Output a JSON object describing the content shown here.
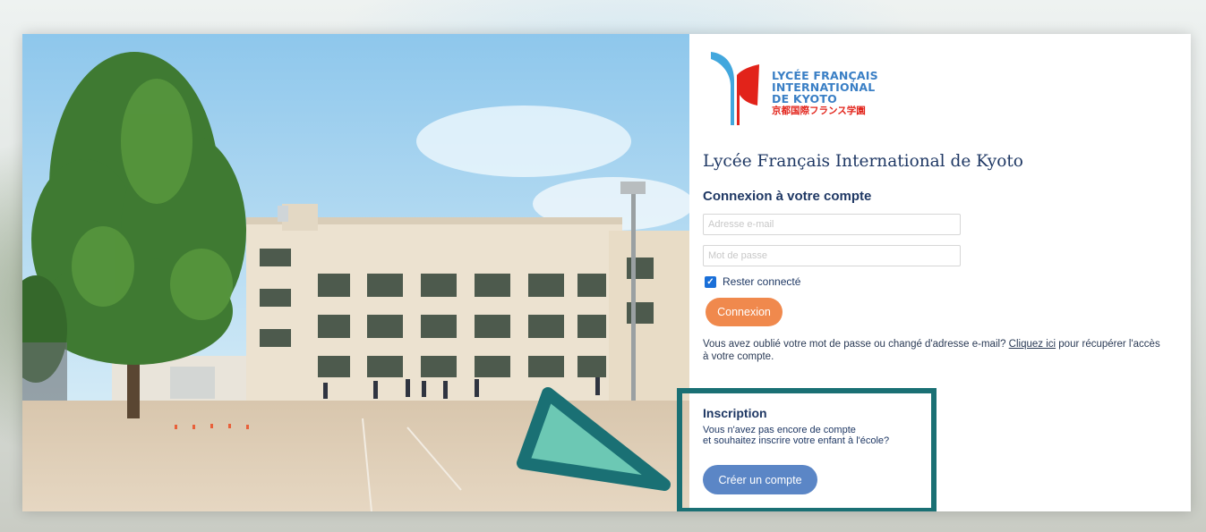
{
  "logo": {
    "lines": [
      "LYCÉE FRANÇAIS",
      "INTERNATIONAL",
      "DE KYOTO"
    ],
    "japanese": "京都国際フランス学園",
    "colors": {
      "blue": "#3a7fc5",
      "red": "#e2231a"
    }
  },
  "school_title": "Lycée Français International de Kyoto",
  "login": {
    "heading": "Connexion à votre compte",
    "email_placeholder": "Adresse e-mail",
    "email_value": "",
    "password_placeholder": "Mot de passe",
    "password_value": "",
    "remember_label": "Rester connecté",
    "remember_checked": true,
    "submit_label": "Connexion",
    "forgot_text_before": "Vous avez oublié votre mot de passe ou changé d'adresse e-mail? ",
    "forgot_link": "Cliquez ici",
    "forgot_text_after": " pour récupérer l'accès à votre compte."
  },
  "signup": {
    "title": "Inscription",
    "line1": "Vous n'avez pas encore de compte",
    "line2": "et souhaitez inscrire votre enfant à l'école?",
    "button_label": "Créer un compte"
  },
  "colors": {
    "connexion_button": "#f0894d",
    "create_button": "#5b86c6",
    "highlight_border": "#1a7074",
    "arrow_fill": "#6cc8b4",
    "heading_text": "#1f3864"
  }
}
